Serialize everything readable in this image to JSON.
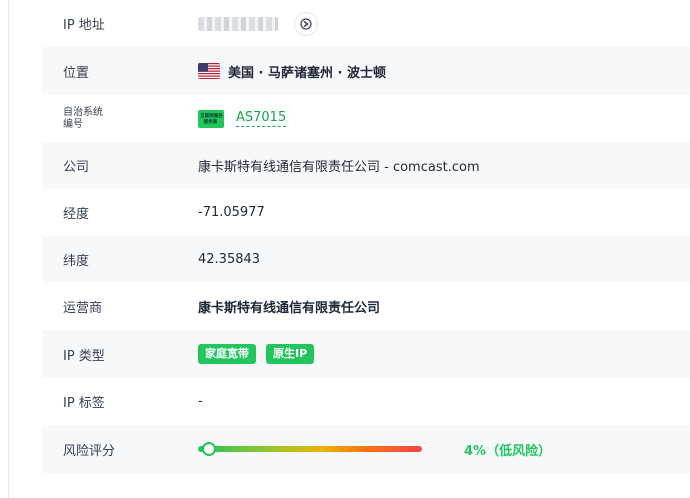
{
  "rows": {
    "ip": {
      "label": "IP 地址"
    },
    "location": {
      "label": "位置",
      "value": "美国 · 马萨诸塞州 · 波士顿"
    },
    "asn": {
      "label_line1": "自治系统",
      "label_line2": "编号",
      "logo_line1": "互联网服务",
      "logo_line2": "提供商",
      "value": "AS7015"
    },
    "company": {
      "label": "公司",
      "value": "康卡斯特有线通信有限责任公司 - comcast.com"
    },
    "longitude": {
      "label": "经度",
      "value": "-71.05977"
    },
    "latitude": {
      "label": "纬度",
      "value": "42.35843"
    },
    "operator": {
      "label": "运营商",
      "value": "康卡斯特有线通信有限责任公司"
    },
    "ip_type": {
      "label": "IP 类型",
      "badges": [
        "家庭宽带",
        "原生IP"
      ]
    },
    "ip_tags": {
      "label": "IP 标签",
      "value": "-"
    },
    "risk": {
      "label": "风险评分",
      "percent": 4,
      "text": "4%（低风险）"
    }
  },
  "colors": {
    "accent": "#22c55e",
    "risk_high": "#ef4444",
    "row_alt": "#f7f8fa"
  },
  "icons": {
    "copy": "copy-icon",
    "flag": "us-flag-icon",
    "asn_logo": "isp-logo-icon"
  }
}
